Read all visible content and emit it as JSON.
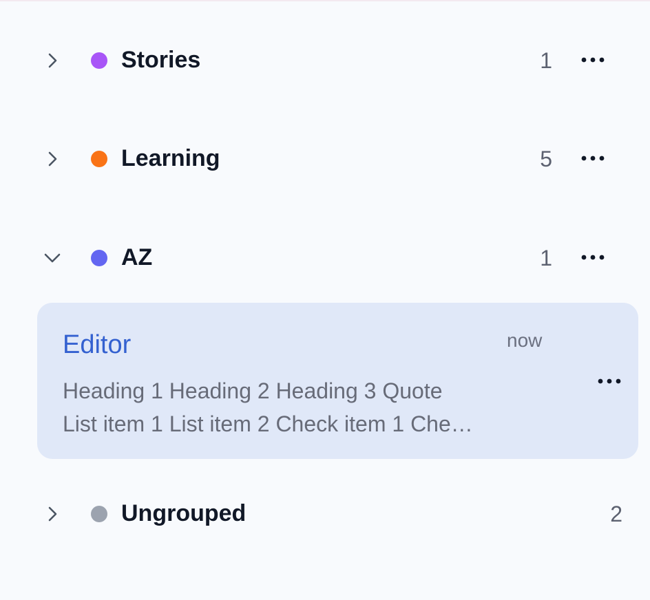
{
  "groups": [
    {
      "name": "Stories",
      "count": "1",
      "expanded": false,
      "color": "#a855f7"
    },
    {
      "name": "Learning",
      "count": "5",
      "expanded": false,
      "color": "#f97316"
    },
    {
      "name": "AZ",
      "count": "1",
      "expanded": true,
      "color": "#6366f1"
    },
    {
      "name": "Ungrouped",
      "count": "2",
      "expanded": false,
      "color": "#9ca3af"
    }
  ],
  "note": {
    "title": "Editor",
    "time": "now",
    "preview_line1": "Heading 1 Heading 2 Heading 3 Quote",
    "preview_line2": "List item 1 List item 2 Check item 1 Che…"
  },
  "colors": {
    "background": "#f8fafd",
    "selected_card": "#e0e8f8",
    "note_title": "#3461d0"
  },
  "icons": {
    "collapsed": "chevron-right-icon",
    "expanded": "chevron-down-icon",
    "menu": "more-horizontal-icon"
  }
}
